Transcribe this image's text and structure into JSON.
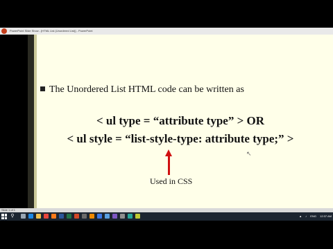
{
  "window": {
    "title": "PowerPoint Slide Show - [HTML List (Unordered List)] - PowerPoint"
  },
  "slide": {
    "bullet": "The Unordered List HTML code can be written as",
    "code_line1": "< ul type = “attribute type” > OR",
    "code_line2": "< ul style = “list-style-type: attribute type;” >",
    "arrow_label": "Used in CSS"
  },
  "status": {
    "slide_number": "Slide 1 of 1"
  },
  "taskbar": {
    "lang": "ENG",
    "time": "12:37 AM",
    "icons": [
      {
        "name": "taskview-icon",
        "color": "#9aa7b4"
      },
      {
        "name": "edge-icon",
        "color": "#1e88e5"
      },
      {
        "name": "explorer-icon",
        "color": "#f2c14e"
      },
      {
        "name": "chrome-icon",
        "color": "#e8453c"
      },
      {
        "name": "firefox-icon",
        "color": "#ff7a1a"
      },
      {
        "name": "word-icon",
        "color": "#2b579a"
      },
      {
        "name": "excel-icon",
        "color": "#217346"
      },
      {
        "name": "powerpoint-icon",
        "color": "#d24726"
      },
      {
        "name": "media-icon",
        "color": "#6a6a6a"
      },
      {
        "name": "vlc-icon",
        "color": "#f08a00"
      },
      {
        "name": "store-icon",
        "color": "#3b78e7"
      },
      {
        "name": "mail-icon",
        "color": "#5aa0e0"
      },
      {
        "name": "photos-icon",
        "color": "#7e57c2"
      },
      {
        "name": "settings-icon",
        "color": "#8f8f8f"
      },
      {
        "name": "app-icon",
        "color": "#26a69a"
      },
      {
        "name": "app2-icon",
        "color": "#c0ca33"
      }
    ]
  }
}
